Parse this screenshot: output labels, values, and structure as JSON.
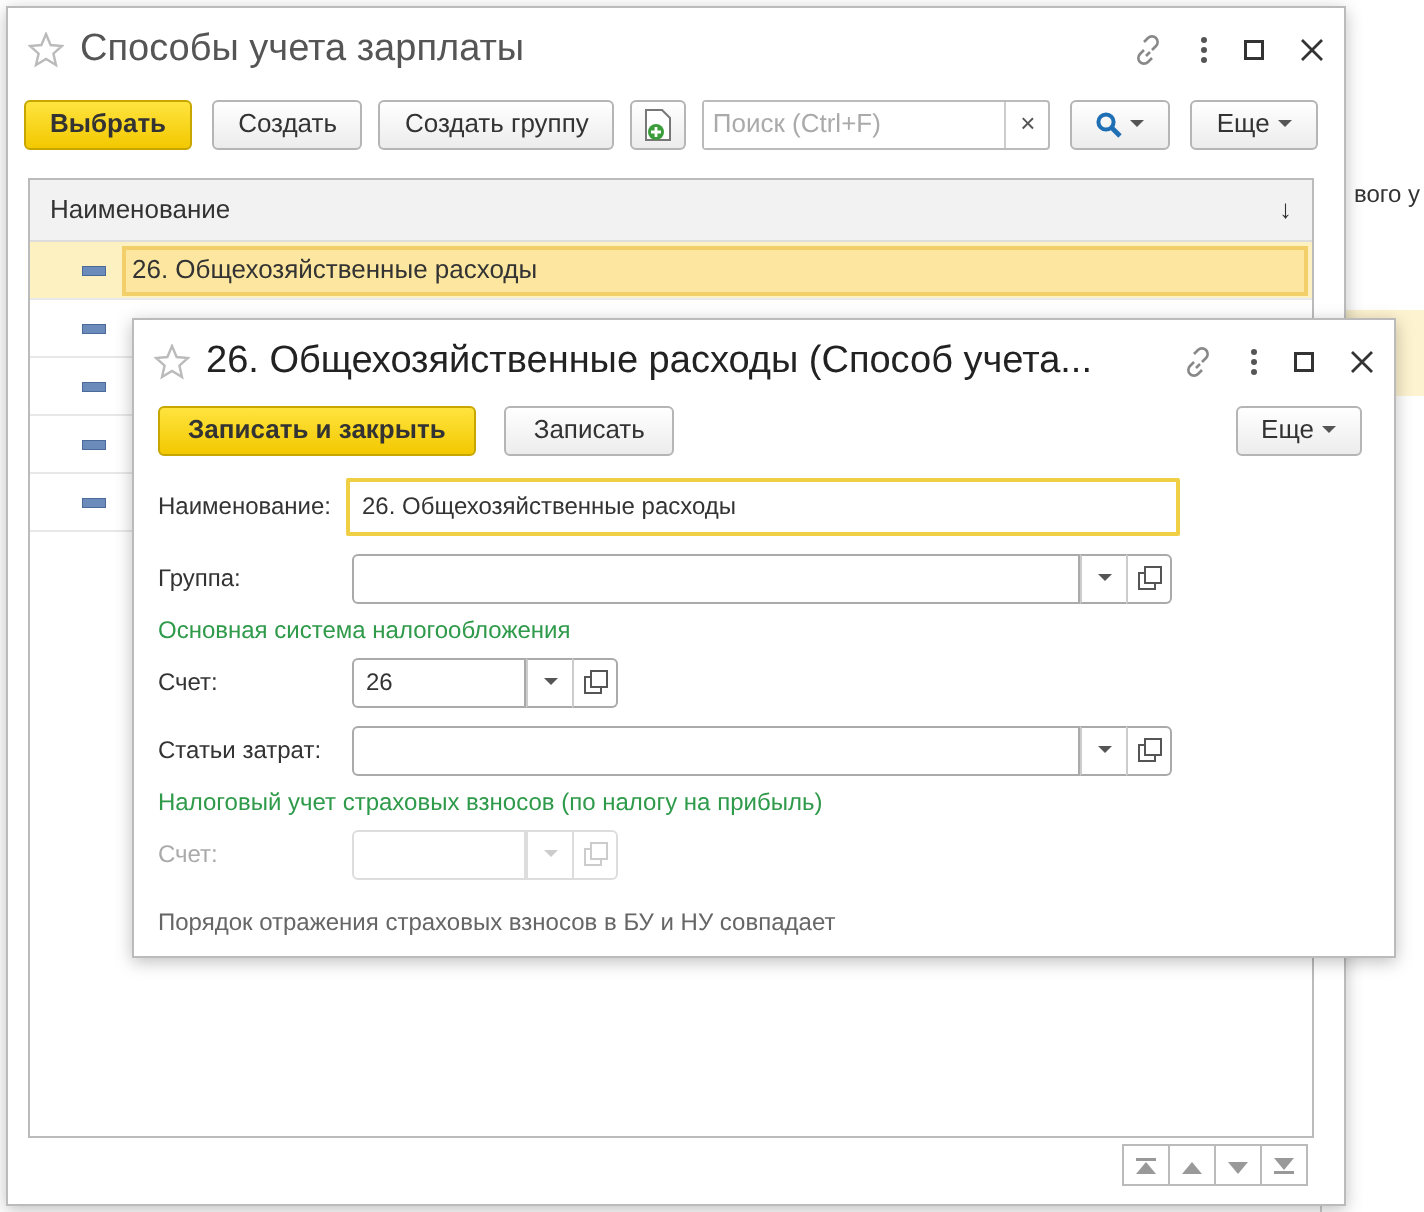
{
  "background_window": {
    "text": "вого у"
  },
  "main_window": {
    "title": "Способы учета зарплаты",
    "toolbar": [
      {
        "kind": "primary",
        "label": "Выбрать"
      },
      {
        "kind": "button",
        "label": "Создать"
      },
      {
        "kind": "button",
        "label": "Создать группу"
      },
      {
        "kind": "icon"
      },
      {
        "kind": "search",
        "placeholder": "Поиск (Ctrl+F)",
        "clear": "×"
      },
      {
        "kind": "search-menu"
      },
      {
        "kind": "menu",
        "label": "Еще"
      }
    ],
    "table": {
      "columns": [
        {
          "label": "Наименование",
          "sort": "↓"
        }
      ],
      "rows": [
        {
          "name": "26. Общехозяйственные расходы",
          "selected": true
        },
        {
          "selected": false
        },
        {
          "selected": false
        },
        {
          "selected": false
        },
        {
          "selected": false
        }
      ]
    }
  },
  "dialog": {
    "title": "26. Общехозяйственные расходы (Способ учета...",
    "buttons": [
      {
        "kind": "primary",
        "label": "Записать и закрыть"
      },
      {
        "kind": "button",
        "label": "Записать"
      },
      {
        "kind": "menu",
        "label": "Еще"
      }
    ],
    "items": [
      {
        "kind": "text",
        "label": "Наименование:",
        "value": "26. Общехозяйственные расходы",
        "focused": true,
        "disabled": false
      },
      {
        "kind": "select",
        "label": "Группа:",
        "wide": true,
        "disabled": false
      },
      {
        "kind": "section",
        "label": "Основная система налогообложения"
      },
      {
        "kind": "select",
        "label": "Счет:",
        "value": "26",
        "wide": false,
        "disabled": false
      },
      {
        "kind": "select",
        "label": "Статьи затрат:",
        "wide": true,
        "disabled": false
      },
      {
        "kind": "section",
        "label": "Налоговый учет страховых взносов (по налогу на прибыль)"
      },
      {
        "kind": "select",
        "label": "Счет:",
        "wide": false,
        "disabled": true
      },
      {
        "kind": "note",
        "label": "Порядок отражения страховых взносов в БУ и НУ совпадает"
      }
    ]
  }
}
